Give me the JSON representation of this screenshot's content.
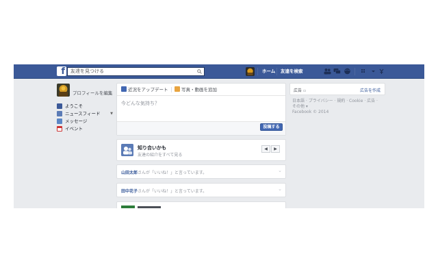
{
  "header": {
    "search_placeholder": "友達を見つける",
    "home_label": "ホーム",
    "find_friends_label": "友達を検索"
  },
  "sidebar": {
    "profile_edit": "プロフィールを編集",
    "items": [
      {
        "label": "ようこそ"
      },
      {
        "label": "ニュースフィード"
      },
      {
        "label": "メッセージ"
      },
      {
        "label": "イベント"
      }
    ]
  },
  "composer": {
    "tab_status": "近況をアップデート",
    "tab_photo": "写真・動画を追加",
    "placeholder": "今どんな気持ち？",
    "post_button": "投稿する"
  },
  "pymk": {
    "title": "知り合いかも",
    "subtitle": "友達の紹介をすべて見る"
  },
  "stories": [
    {
      "name": "山田太郎",
      "text": "さんが「いいね！」と言っています。"
    },
    {
      "name": "田中花子",
      "text": "さんが「いいね！」と言っています。"
    }
  ],
  "right": {
    "ad_label": "広告",
    "ad_create": "広告を作成",
    "footer_line1": "日本語 · プライバシー · 規約 · Cookie · 広告 ·",
    "footer_line2": "その他 ▾",
    "copyright": "Facebook © 2014"
  },
  "colors": {
    "brand_blue": "#3b5998",
    "button_blue": "#4267b2",
    "page_bg": "#e9ebee"
  }
}
